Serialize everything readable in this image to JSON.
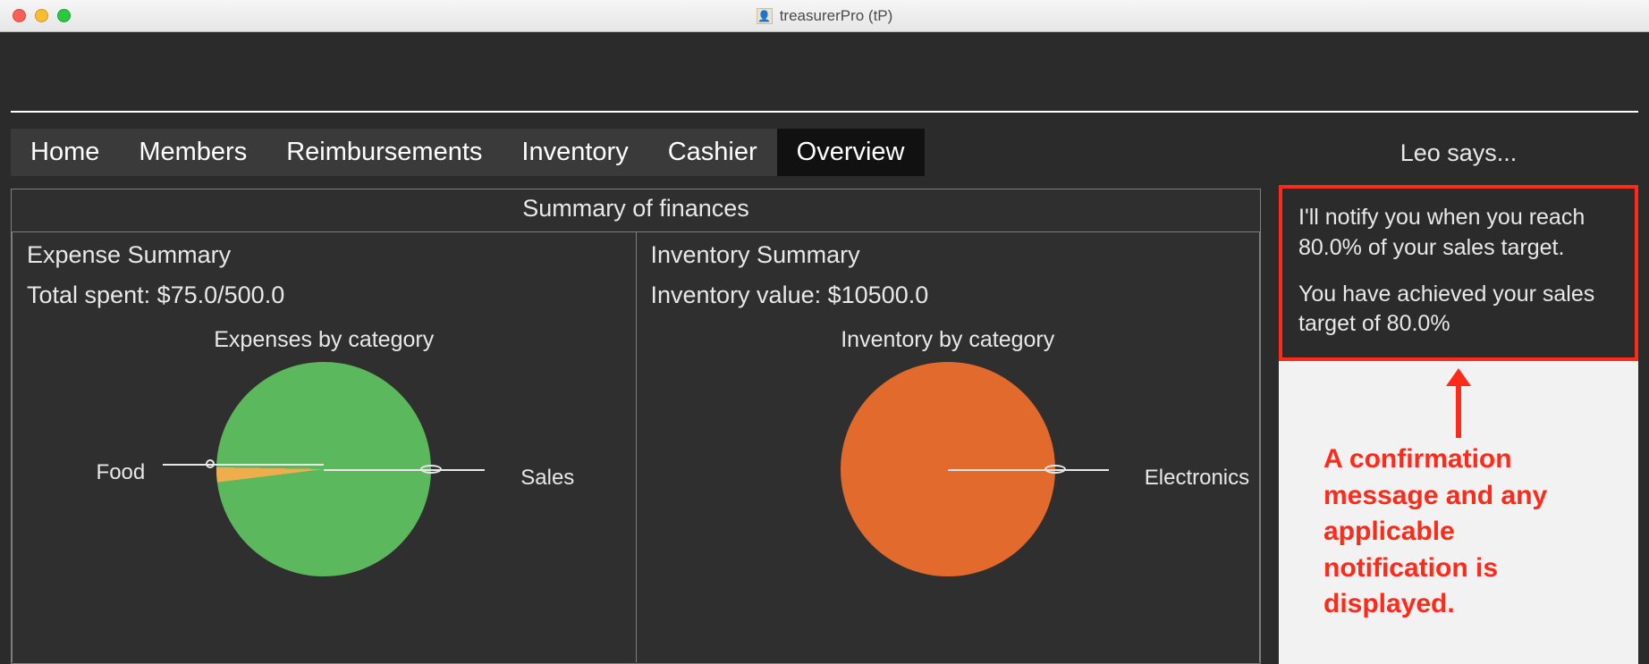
{
  "window": {
    "title": "treasurerPro (tP)"
  },
  "tabs": {
    "items": [
      {
        "label": "Home"
      },
      {
        "label": "Members"
      },
      {
        "label": "Reimbursements"
      },
      {
        "label": "Inventory"
      },
      {
        "label": "Cashier"
      },
      {
        "label": "Overview"
      }
    ],
    "active_index": 5
  },
  "summary": {
    "title": "Summary of finances",
    "expense": {
      "heading": "Expense Summary",
      "total_label": "Total spent: $75.0/500.0",
      "chart_title": "Expenses by category",
      "labels": {
        "left": "Food",
        "right": "Sales"
      }
    },
    "inventory": {
      "heading": "Inventory Summary",
      "value_label": "Inventory value: $10500.0",
      "chart_title": "Inventory by category",
      "labels": {
        "right": "Electronics"
      }
    }
  },
  "leo": {
    "header": "Leo says...",
    "line1": "I'll notify you when you reach 80.0% of your sales target.",
    "line2": "You have achieved your sales target of 80.0%"
  },
  "annotation": {
    "text": "A confirmation message and any applicable notification is displayed."
  },
  "colors": {
    "accent_red": "#ff2a1a",
    "pie_green": "#5cb85c",
    "pie_orange_wedge": "#f0ad4e",
    "pie_orange": "#e26a2c"
  },
  "chart_data": [
    {
      "type": "pie",
      "title": "Expenses by category",
      "series": [
        {
          "name": "Sales",
          "value": 73,
          "color": "#5cb85c"
        },
        {
          "name": "Food",
          "value": 2,
          "color": "#f0ad4e"
        }
      ],
      "total": 75.0,
      "budget": 500.0
    },
    {
      "type": "pie",
      "title": "Inventory by category",
      "series": [
        {
          "name": "Electronics",
          "value": 10500.0,
          "color": "#e26a2c"
        }
      ],
      "total": 10500.0
    }
  ]
}
